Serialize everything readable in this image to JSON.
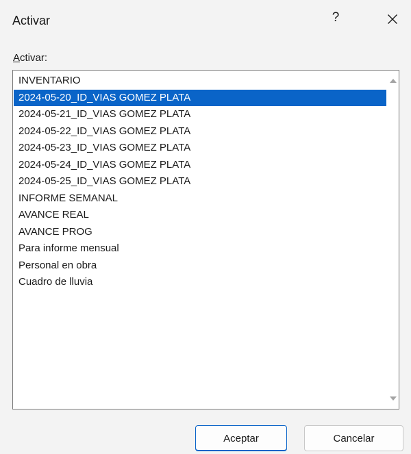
{
  "dialog": {
    "title": "Activar",
    "help_label": "?",
    "close_icon": "close-icon"
  },
  "list": {
    "label_accel": "A",
    "label_rest": "ctivar:",
    "selected_index": 1,
    "items": [
      "INVENTARIO",
      "2024-05-20_ID_VIAS GOMEZ PLATA",
      "2024-05-21_ID_VIAS GOMEZ PLATA",
      "2024-05-22_ID_VIAS GOMEZ PLATA",
      "2024-05-23_ID_VIAS GOMEZ PLATA",
      "2024-05-24_ID_VIAS GOMEZ PLATA",
      "2024-05-25_ID_VIAS GOMEZ PLATA",
      "INFORME SEMANAL",
      "AVANCE REAL",
      "AVANCE PROG",
      "Para informe mensual",
      "Personal en obra",
      "Cuadro de lluvia"
    ]
  },
  "buttons": {
    "ok_label": "Aceptar",
    "cancel_label": "Cancelar"
  },
  "colors": {
    "selection": "#0a64c8",
    "background": "#f3f3f3"
  }
}
